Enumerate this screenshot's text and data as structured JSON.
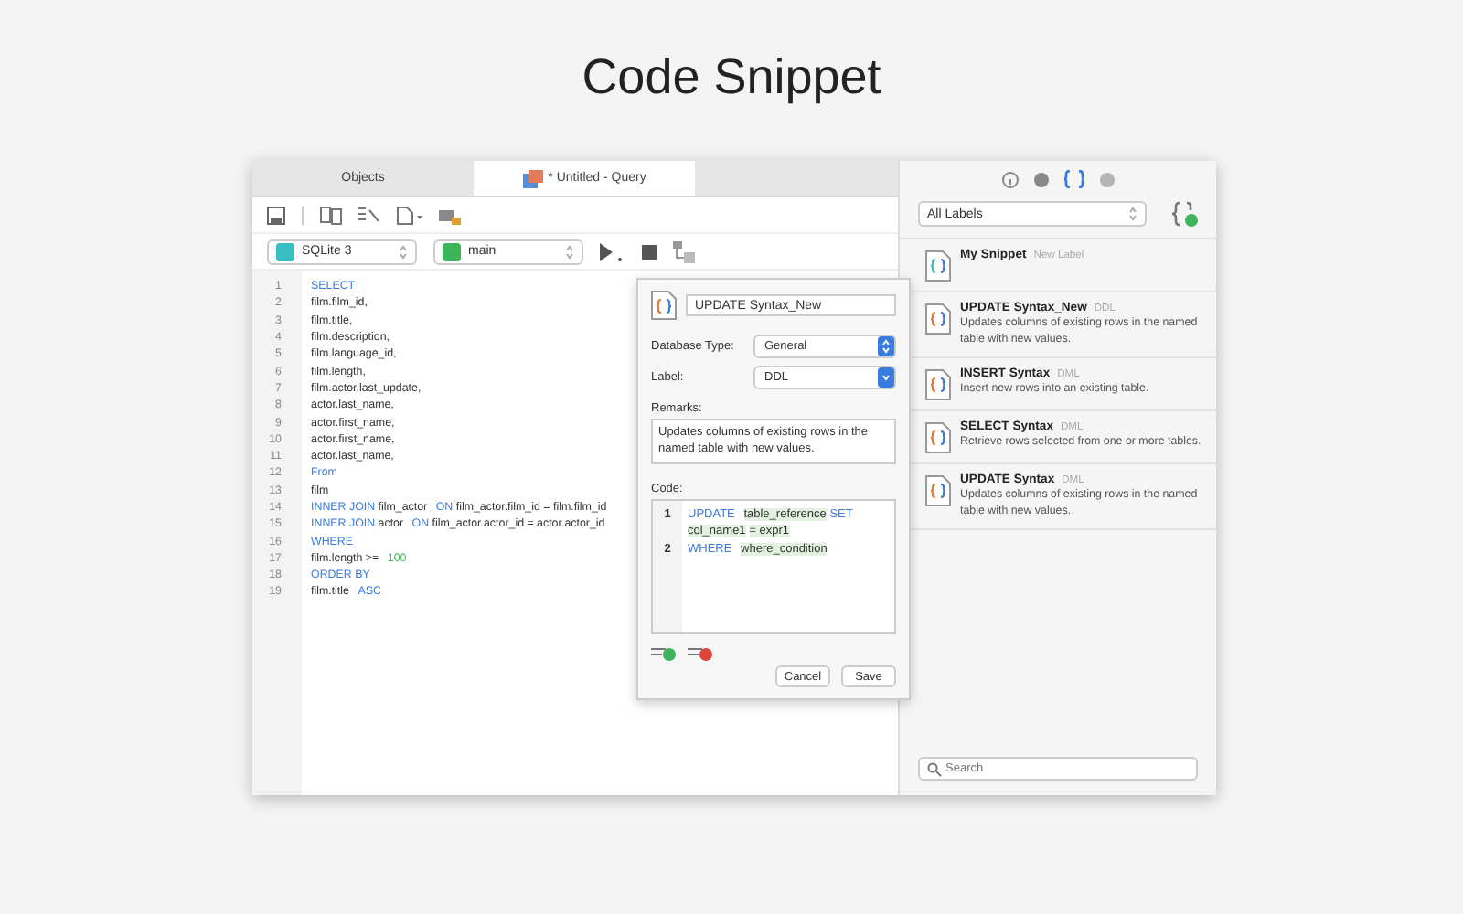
{
  "heading": "Code Snippet",
  "tabs": [
    {
      "label": "Objects",
      "selected": false
    },
    {
      "label": "* Untitled - Query",
      "selected": true
    }
  ],
  "connection": {
    "value": "SQLite 3"
  },
  "database": {
    "value": "main"
  },
  "editor_lines": [
    {
      "number": "1",
      "tokens": [
        {
          "text": "SELECT",
          "kind": "kw"
        }
      ]
    },
    {
      "number": "2",
      "tokens": [
        {
          "text": "film.film_id,",
          "kind": "plain"
        }
      ]
    },
    {
      "number": "3",
      "tokens": [
        {
          "text": "film.title,",
          "kind": "plain"
        }
      ]
    },
    {
      "number": "4",
      "tokens": [
        {
          "text": "film.description,",
          "kind": "plain"
        }
      ]
    },
    {
      "number": "5",
      "tokens": [
        {
          "text": "film.language_id,",
          "kind": "plain"
        }
      ]
    },
    {
      "number": "6",
      "tokens": [
        {
          "text": "film.length,",
          "kind": "plain"
        }
      ]
    },
    {
      "number": "7",
      "tokens": [
        {
          "text": "film.actor.last_update,",
          "kind": "plain"
        }
      ]
    },
    {
      "number": "8",
      "tokens": [
        {
          "text": "actor.last_name,",
          "kind": "plain"
        }
      ]
    },
    {
      "number": "9",
      "tokens": [
        {
          "text": "actor.first_name,",
          "kind": "plain"
        }
      ]
    },
    {
      "number": "10",
      "tokens": [
        {
          "text": "actor.first_name,",
          "kind": "plain"
        }
      ]
    },
    {
      "number": "11",
      "tokens": [
        {
          "text": "actor.last_name,",
          "kind": "plain"
        }
      ]
    },
    {
      "number": "12",
      "tokens": [
        {
          "text": "From",
          "kind": "kw"
        }
      ]
    },
    {
      "number": "13",
      "tokens": [
        {
          "text": "film",
          "kind": "plain"
        }
      ]
    },
    {
      "number": "14",
      "tokens": [
        {
          "text": "INNER JOIN",
          "kind": "kw"
        },
        {
          "text": "film_actor",
          "kind": "plain"
        },
        {
          "text": "ON",
          "kind": "kw"
        },
        {
          "text": "film_actor.film_id = film.film_id",
          "kind": "plain"
        }
      ]
    },
    {
      "number": "15",
      "tokens": [
        {
          "text": "INNER JOIN",
          "kind": "kw"
        },
        {
          "text": "actor",
          "kind": "plain"
        },
        {
          "text": "ON",
          "kind": "kw"
        },
        {
          "text": "film_actor.actor_id = actor.actor_id",
          "kind": "plain"
        }
      ]
    },
    {
      "number": "16",
      "tokens": [
        {
          "text": "WHERE",
          "kind": "kw"
        }
      ]
    },
    {
      "number": "17",
      "tokens": [
        {
          "text": "film.length >=",
          "kind": "plain"
        },
        {
          "text": "100",
          "kind": "num"
        }
      ]
    },
    {
      "number": "18",
      "tokens": [
        {
          "text": "ORDER BY",
          "kind": "kw"
        }
      ]
    },
    {
      "number": "19",
      "tokens": [
        {
          "text": "film.title",
          "kind": "plain"
        },
        {
          "text": "ASC",
          "kind": "kw"
        }
      ]
    }
  ],
  "snippet_editor": {
    "name": "UPDATE Syntax_New",
    "database_type": {
      "label": "Database Type:",
      "value": "General"
    },
    "label_field": {
      "label": "Label:",
      "value": "DDL"
    },
    "remarks": {
      "label": "Remarks:",
      "value": "Updates columns of existing rows in the named table with new values."
    },
    "code": {
      "label": "Code:",
      "lines": [
        {
          "number": "1",
          "tokens": [
            {
              "text": "UPDATE",
              "kind": "kw"
            },
            {
              "text": "table_reference",
              "kind": "ph"
            },
            {
              "text": "SET",
              "kind": "kw"
            },
            {
              "text": "col_name1",
              "kind": "ph"
            },
            {
              "text": "= expr1",
              "kind": "ph"
            }
          ]
        },
        {
          "number": "2",
          "tokens": [
            {
              "text": "WHERE",
              "kind": "kw"
            },
            {
              "text": "where_condition",
              "kind": "ph"
            }
          ]
        }
      ]
    },
    "buttons": [
      "Cancel",
      "Save"
    ]
  },
  "panel_tabs": [
    {
      "selected": false,
      "kind": "info"
    },
    {
      "selected": false,
      "kind": "dot"
    },
    {
      "selected": true,
      "kind": "braces"
    },
    {
      "selected": false,
      "kind": "gear"
    }
  ],
  "label_filter": {
    "value": "All Labels"
  },
  "snippets": [
    {
      "name": "My Snippet",
      "tag": "New Label"
    },
    {
      "name": "UPDATE Syntax_New",
      "tag": "DDL",
      "description": "Updates columns of existing rows in the named table with new values."
    },
    {
      "name": "INSERT Syntax",
      "tag": "DML",
      "description": "Insert new rows into an existing table."
    },
    {
      "name": "SELECT Syntax",
      "tag": "DML",
      "description": "Retrieve rows selected from one or more tables."
    },
    {
      "name": "UPDATE Syntax",
      "tag": "DML",
      "description": "Updates columns of existing rows in the named table with new values."
    }
  ],
  "search": {
    "placeholder": "Search"
  }
}
